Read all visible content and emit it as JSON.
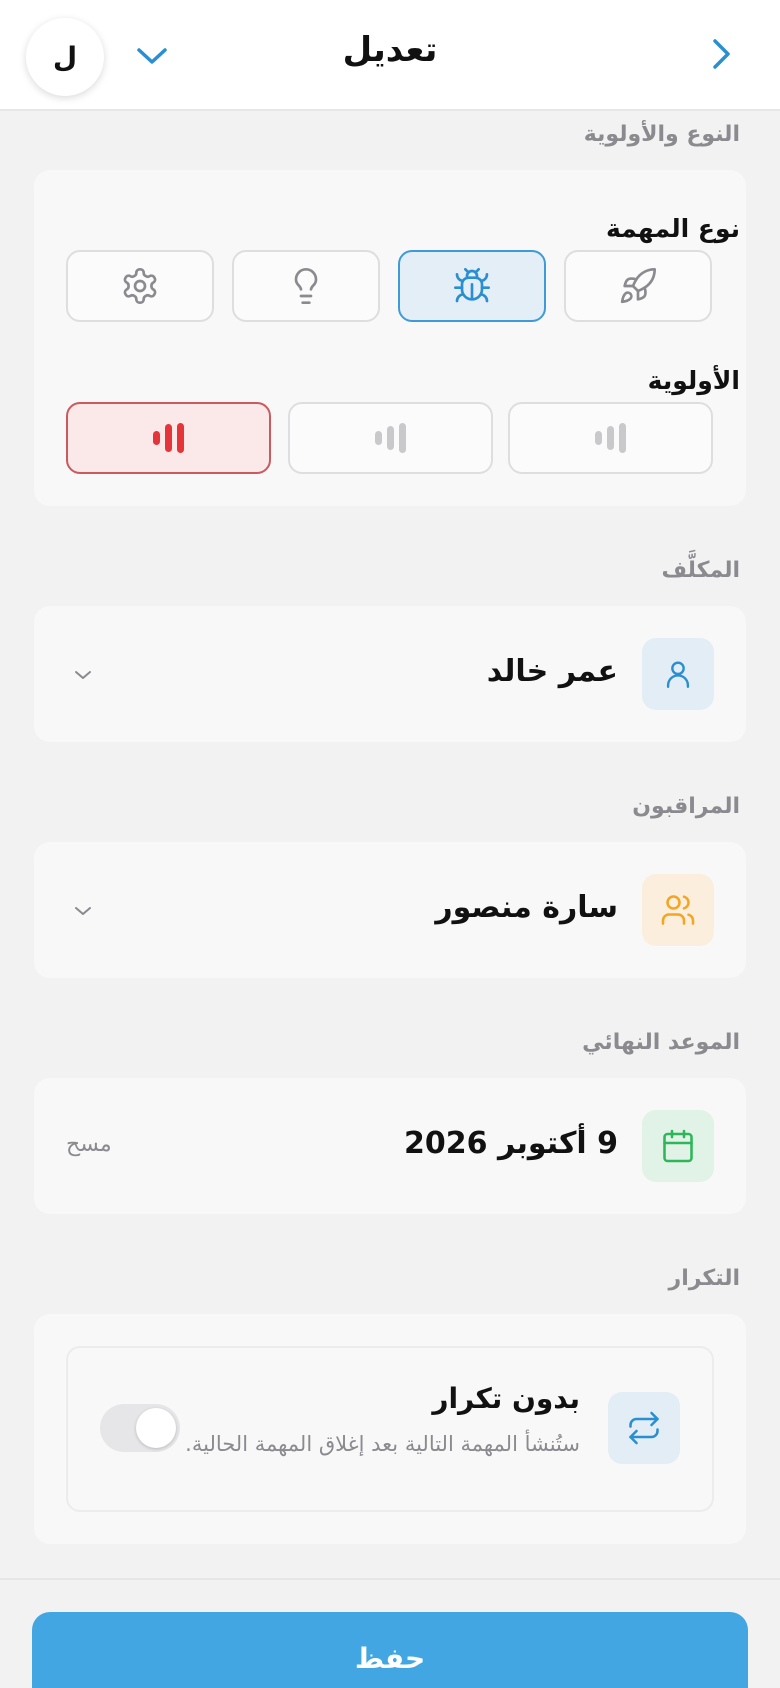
{
  "header": {
    "title": "تعديل",
    "avatar_letter": "ل"
  },
  "type_priority": {
    "section_label": "النوع والأولوية",
    "task_type_label": "نوع المهمة",
    "task_types": [
      {
        "icon": "rocket-icon",
        "selected": false
      },
      {
        "icon": "bug-icon",
        "selected": true
      },
      {
        "icon": "lightbulb-icon",
        "selected": false
      },
      {
        "icon": "gear-icon",
        "selected": false
      }
    ],
    "priority_label": "الأولوية",
    "priorities": [
      {
        "level": "low",
        "selected": false
      },
      {
        "level": "medium",
        "selected": false
      },
      {
        "level": "high",
        "selected": true
      }
    ]
  },
  "assignee": {
    "section_label": "المكلَّف",
    "value": "عمر خالد",
    "icon": "user-icon"
  },
  "watchers": {
    "section_label": "المراقبون",
    "value": "سارة منصور",
    "icon": "users-icon"
  },
  "due_date": {
    "section_label": "الموعد النهائي",
    "value": "9 أكتوبر 2026",
    "clear_label": "مسح",
    "icon": "calendar-icon"
  },
  "repeat": {
    "section_label": "التكرار",
    "title": "بدون تكرار",
    "description": "ستُنشأ المهمة التالية بعد إغلاق المهمة الحالية.",
    "enabled": false,
    "icon": "repeat-icon"
  },
  "footer": {
    "save_label": "حفظ"
  },
  "colors": {
    "accent": "#42a6e2",
    "selected_type_bg": "#e4eef7",
    "priority_high": "#e4353b",
    "watchers_accent": "#f2a623",
    "date_accent": "#2fb55a"
  }
}
